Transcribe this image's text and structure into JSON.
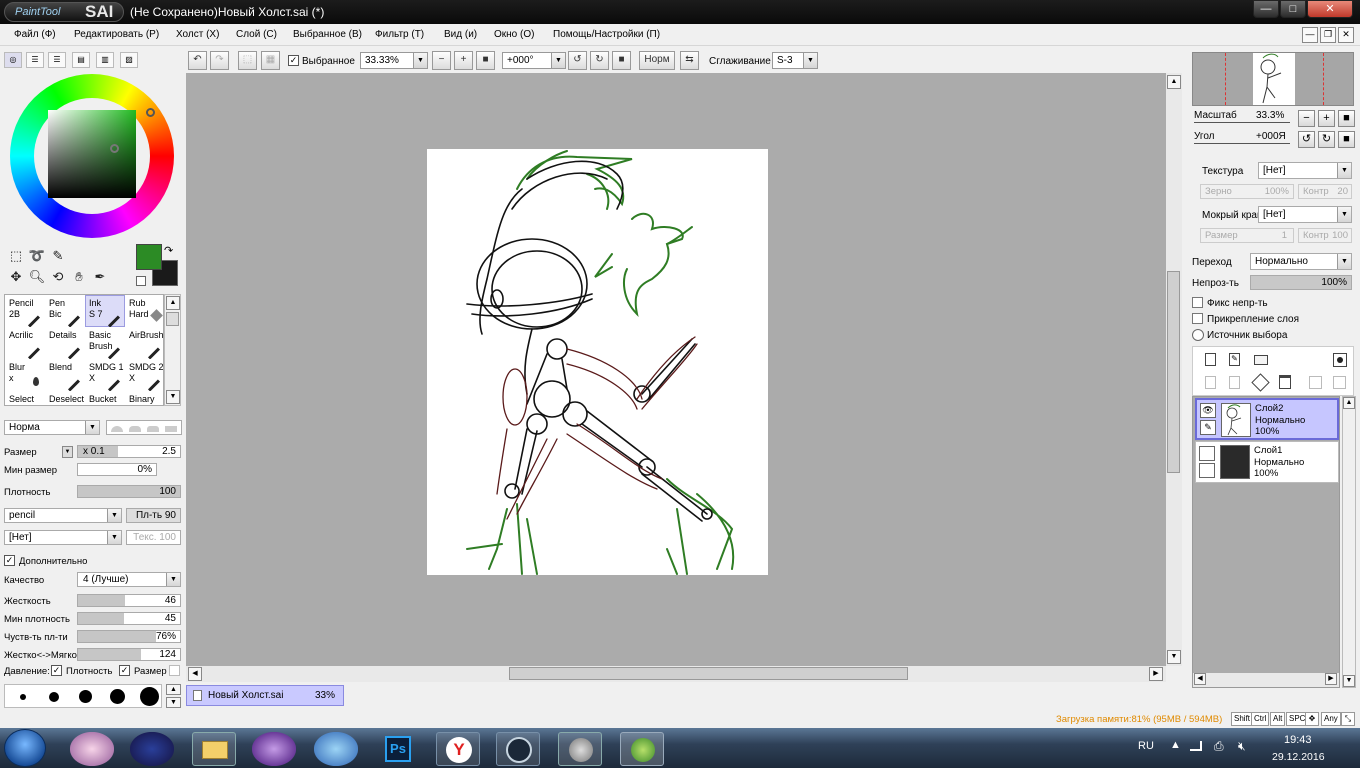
{
  "window": {
    "logo_small": "PaintTool",
    "logo_big": "SAI",
    "title": "(Не Сохранено)Новый Холст.sai (*)",
    "btn_min": "—",
    "btn_max": "□",
    "btn_close": "✕"
  },
  "menu": [
    "Файл (Ф)",
    "Редактировать (Р)",
    "Холст (X)",
    "Слой (С)",
    "Выбранное (В)",
    "Фильтр (Т)",
    "Вид (и)",
    "Окно (О)",
    "Помощь/Настройки (П)"
  ],
  "toolbar": {
    "selected_label": "Выбранное",
    "selected_checked": true,
    "zoom_value": "33.33%",
    "rotation_value": "+000°",
    "mode_label": "Норм",
    "smoothing_label": "Сглаживание",
    "smoothing_value": "S-3"
  },
  "left_panel": {
    "brushes": [
      {
        "name": "Pencil",
        "sub": "2B"
      },
      {
        "name": "Pen",
        "sub": "Bic"
      },
      {
        "name": "Ink",
        "sub": "S 7"
      },
      {
        "name": "Rub",
        "sub": "Hard"
      },
      {
        "name": "Acrilic",
        "sub": ""
      },
      {
        "name": "Details",
        "sub": ""
      },
      {
        "name": "Basic",
        "sub": "Brush"
      },
      {
        "name": "AirBrush",
        "sub": ""
      },
      {
        "name": "Blur",
        "sub": "x"
      },
      {
        "name": "Blend",
        "sub": ""
      },
      {
        "name": "SMDG 1",
        "sub": "X"
      },
      {
        "name": "SMDG 2",
        "sub": "X"
      },
      {
        "name": "Select",
        "sub": ""
      },
      {
        "name": "Deselect",
        "sub": ""
      },
      {
        "name": "Bucket",
        "sub": ""
      },
      {
        "name": "Binary",
        "sub": ""
      }
    ],
    "blend_mode": "Норма",
    "size_label": "Размер",
    "size_mult": "x 0.1",
    "size_value": "2.5",
    "min_size_label": "Мин размер",
    "min_size_value": "0%",
    "density_label": "Плотность",
    "density_value": "100",
    "density_level": 1.0,
    "shape": "pencil",
    "shape_strength": "Пл-ть 90",
    "texture": "[Нет]",
    "texture_strength": "Текс. 100",
    "advanced_label": "Дополнительно",
    "advanced_checked": true,
    "quality_label": "Качество",
    "quality_value": "4 (Лучше)",
    "hardness_label": "Жесткость",
    "hardness_value": "46",
    "hardness_level": 0.46,
    "min_density_label": "Мин плотность",
    "min_density_value": "45",
    "min_density_level": 0.45,
    "sensitivity_label": "Чуств-ть пл-ти",
    "sensitivity_value": "76%",
    "sensitivity_level": 0.76,
    "soft_label": "Жестко<->Мягко",
    "soft_value": "124",
    "soft_level": 0.62,
    "pressure_label": "Давление:",
    "pressure_density": "Плотность",
    "pressure_size": "Размер",
    "fg_color": "#2c8b25",
    "bg_color": "#1a1a1a"
  },
  "canvas": {
    "doc_tab_name": "Новый Холст.sai",
    "doc_tab_zoom": "33%"
  },
  "right_panel": {
    "scale_label": "Масштаб",
    "scale_value": "33.3%",
    "angle_label": "Угол",
    "angle_value": "+000Я",
    "texture_label": "Текстура",
    "texture_value": "[Нет]",
    "grain_label": "Зерно",
    "grain_value": "100%",
    "contrast_label": "Контр",
    "contrast_value": "20",
    "wet_edge_label": "Мокрый край",
    "wet_edge_value": "[Нет]",
    "size_label": "Размер",
    "size_value": "1",
    "contrast2_label": "Контр",
    "contrast2_value": "100",
    "blend_label": "Переход",
    "blend_value": "Нормально",
    "opacity_label": "Непроз-ть",
    "opacity_value": "100%",
    "preserve_opacity": "Фикс непр-ть",
    "clip_layer": "Прикрепление слоя",
    "selection_source": "Источник выбора",
    "layers": [
      {
        "name": "Слой2",
        "mode": "Нормально",
        "opacity": "100%",
        "selected": true
      },
      {
        "name": "Слой1",
        "mode": "Нормально",
        "opacity": "100%",
        "selected": false
      }
    ]
  },
  "status": {
    "memory": "Загрузка памяти:81% (95MB / 594MB)",
    "keys": [
      "Shift",
      "Ctrl",
      "Alt",
      "SPC",
      "Any"
    ]
  },
  "taskbar": {
    "lang": "RU",
    "time": "19:43",
    "date": "29.12.2016"
  }
}
